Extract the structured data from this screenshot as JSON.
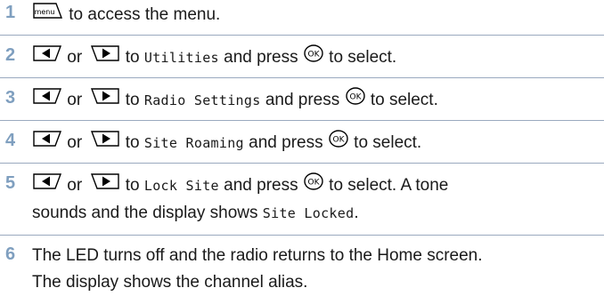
{
  "steps": [
    {
      "num": "1",
      "text": "to access the menu."
    },
    {
      "num": "2",
      "or": "or",
      "to": "to",
      "item": "Utilities",
      "press": "and press",
      "tail": "to select."
    },
    {
      "num": "3",
      "or": "or",
      "to": "to",
      "item": "Radio Settings",
      "press": "and press",
      "tail": "to select."
    },
    {
      "num": "4",
      "or": "or",
      "to": "to",
      "item": "Site Roaming",
      "press": "and press",
      "tail": "to select."
    },
    {
      "num": "5",
      "or": "or",
      "to": "to",
      "item": "Lock Site",
      "press": "and press",
      "tail": "to select. A tone",
      "line2": "sounds and the display shows",
      "item2": "Site Locked",
      "line2_end": "."
    },
    {
      "num": "6",
      "line1": "The LED turns off and the radio returns to the Home screen.",
      "line2": "The display shows the channel alias."
    }
  ],
  "icons": {
    "menu_key": "menu",
    "left_key": "left-arrow-key",
    "right_key": "right-arrow-key",
    "ok_key": "ok-button"
  },
  "colors": {
    "step_number": "#7f9fbf",
    "rule": "#9aa9bf"
  }
}
